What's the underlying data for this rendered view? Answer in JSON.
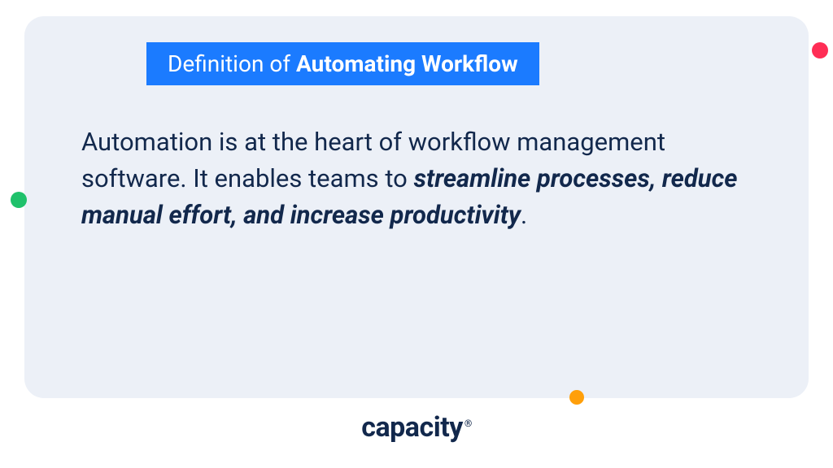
{
  "banner": {
    "prefix": "Definition of ",
    "bold": "Automating Workflow"
  },
  "body": {
    "lead": "Automation is at the heart of workflow management software. It enables teams to ",
    "emph": "streamline processes, reduce manual effort, and increase productivity",
    "tail": "."
  },
  "brand": {
    "name": "capacity",
    "mark": "®"
  },
  "colors": {
    "cardBg": "#ecf0f7",
    "banner": "#1b7bff",
    "text": "#12284c",
    "dotRed": "#ff2d55",
    "dotGreen": "#1fc16b",
    "dotOrange": "#ff9f0a"
  }
}
